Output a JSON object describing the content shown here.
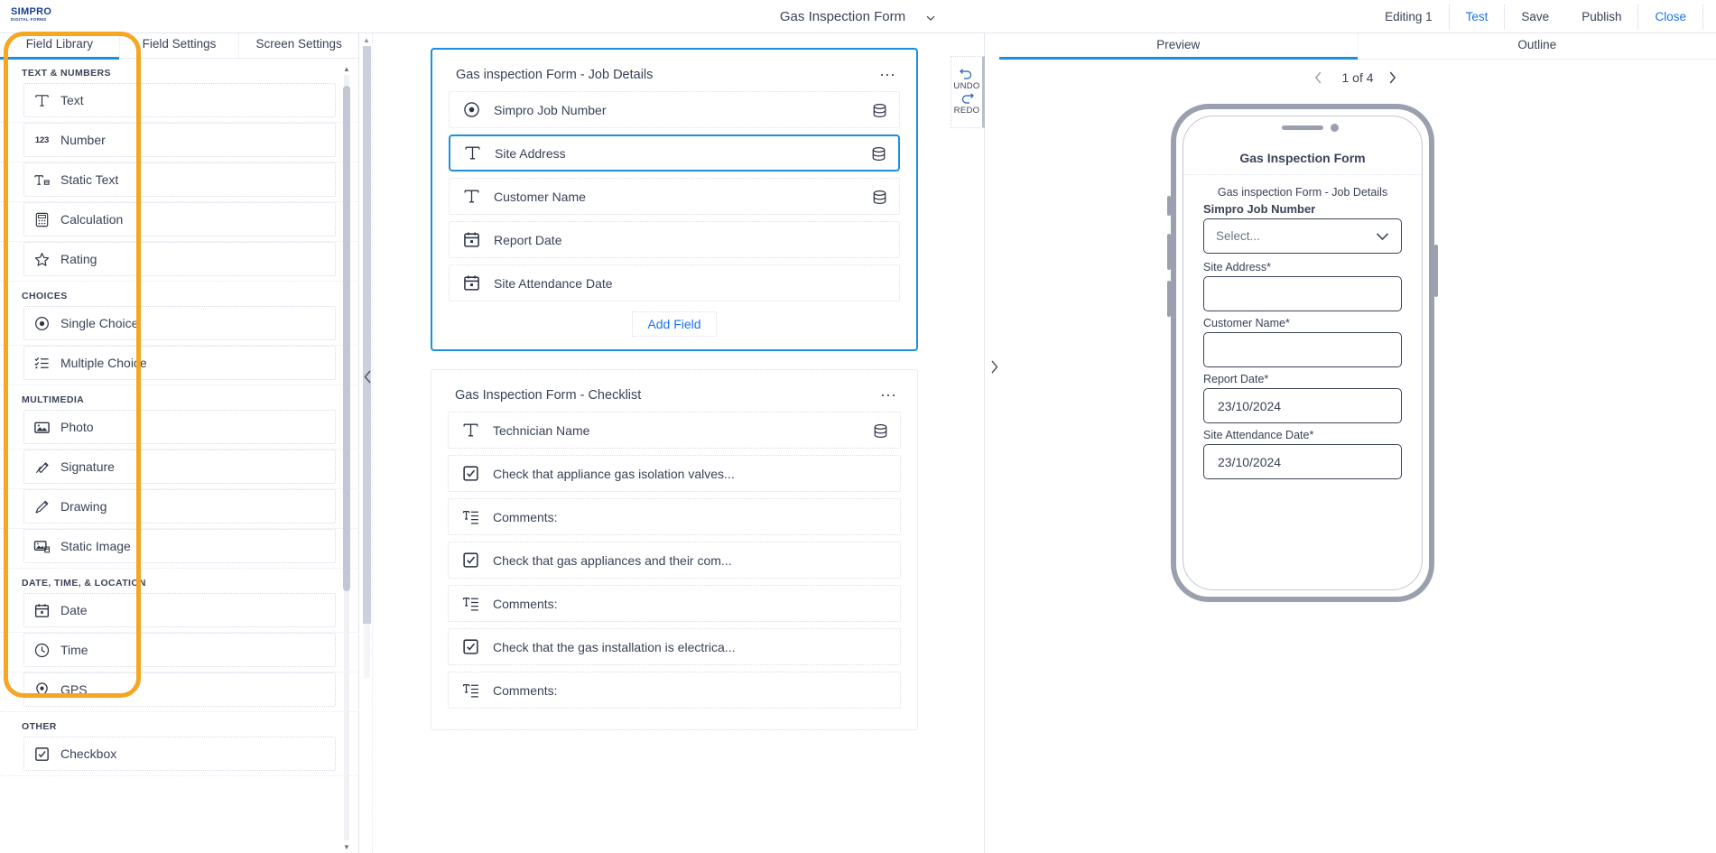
{
  "topbar": {
    "logo_main": "SIMPRO",
    "logo_sub": "DIGITAL FORMS",
    "doc_title": "Gas Inspection Form",
    "chevron_icon": "chevron-down-icon",
    "editing": "Editing 1",
    "test": "Test",
    "save": "Save",
    "publish": "Publish",
    "close": "Close"
  },
  "left_panel": {
    "tabs": [
      {
        "label": "Field Library",
        "active": true
      },
      {
        "label": "Field Settings",
        "active": false
      },
      {
        "label": "Screen Settings",
        "active": false
      }
    ],
    "groups": [
      {
        "label": "TEXT & NUMBERS",
        "items": [
          {
            "label": "Text",
            "icon": "text-icon"
          },
          {
            "label": "Number",
            "icon": "number-icon"
          },
          {
            "label": "Static Text",
            "icon": "static-text-icon"
          },
          {
            "label": "Calculation",
            "icon": "calculator-icon"
          },
          {
            "label": "Rating",
            "icon": "star-icon"
          }
        ]
      },
      {
        "label": "CHOICES",
        "items": [
          {
            "label": "Single Choice",
            "icon": "radio-button-icon"
          },
          {
            "label": "Multiple Choice",
            "icon": "checklist-icon"
          }
        ]
      },
      {
        "label": "MULTIMEDIA",
        "items": [
          {
            "label": "Photo",
            "icon": "photo-icon"
          },
          {
            "label": "Signature",
            "icon": "signature-pen-icon"
          },
          {
            "label": "Drawing",
            "icon": "pencil-icon"
          },
          {
            "label": "Static Image",
            "icon": "static-image-icon"
          }
        ]
      },
      {
        "label": "DATE, TIME, & LOCATION",
        "items": [
          {
            "label": "Date",
            "icon": "calendar-icon"
          },
          {
            "label": "Time",
            "icon": "clock-icon"
          },
          {
            "label": "GPS",
            "icon": "map-pin-icon"
          }
        ]
      },
      {
        "label": "OTHER",
        "items": [
          {
            "label": "Checkbox",
            "icon": "checkbox-icon"
          }
        ]
      }
    ]
  },
  "annotation": {
    "color": "#f5a623",
    "shape": "rounded-rectangle-highlight"
  },
  "canvas": {
    "collapse_left_icon": "chevron-left-icon",
    "collapse_right_icon": "chevron-right-icon",
    "cards": [
      {
        "title": "Gas inspection Form - Job Details",
        "selected": true,
        "menu_icon": "ellipsis-icon",
        "add_field_label": "Add Field",
        "rows": [
          {
            "label": "Simpro Job  Number",
            "icon": "radio-button-icon",
            "db": true,
            "active": false
          },
          {
            "label": "Site Address",
            "icon": "text-icon",
            "db": true,
            "active": true
          },
          {
            "label": "Customer Name",
            "icon": "text-icon",
            "db": true,
            "active": false
          },
          {
            "label": "Report Date",
            "icon": "calendar-icon",
            "db": false,
            "active": false
          },
          {
            "label": "Site Attendance Date",
            "icon": "calendar-icon",
            "db": false,
            "active": false
          }
        ]
      },
      {
        "title": "Gas Inspection Form - Checklist",
        "selected": false,
        "menu_icon": "ellipsis-icon",
        "add_field_label": "",
        "rows": [
          {
            "label": "Technician Name",
            "icon": "text-icon",
            "db": true,
            "active": false
          },
          {
            "label": "Check that appliance gas isolation valves...",
            "icon": "checkbox-icon",
            "db": false,
            "active": false
          },
          {
            "label": "Comments:",
            "icon": "multiline-text-icon",
            "db": false,
            "active": false
          },
          {
            "label": "Check that gas appliances and their com...",
            "icon": "checkbox-icon",
            "db": false,
            "active": false
          },
          {
            "label": "Comments:",
            "icon": "multiline-text-icon",
            "db": false,
            "active": false
          },
          {
            "label": "Check that the gas installation is electrica...",
            "icon": "checkbox-icon",
            "db": false,
            "active": false
          },
          {
            "label": "Comments:",
            "icon": "multiline-text-icon",
            "db": false,
            "active": false
          }
        ]
      }
    ]
  },
  "history": {
    "undo_label": "UNDO",
    "redo_label": "REDO",
    "undo_icon": "undo-arrow-icon",
    "redo_icon": "redo-arrow-icon"
  },
  "right_panel": {
    "tabs": [
      {
        "label": "Preview",
        "active": true
      },
      {
        "label": "Outline",
        "active": false
      }
    ],
    "pager": {
      "prev_icon": "chevron-left-icon",
      "next_icon": "chevron-right-icon",
      "text": "1 of 4"
    },
    "phone": {
      "form_title": "Gas Inspection Form",
      "section_title": "Gas inspection Form - Job Details",
      "fields": [
        {
          "label": "Simpro Job Number",
          "type": "select",
          "value": "Select...",
          "bold": true
        },
        {
          "label": "Site Address*",
          "type": "textarea",
          "value": ""
        },
        {
          "label": "Customer Name*",
          "type": "textarea",
          "value": ""
        },
        {
          "label": "Report Date*",
          "type": "text",
          "value": "23/10/2024"
        },
        {
          "label": "Site Attendance Date*",
          "type": "text",
          "value": "23/10/2024"
        }
      ]
    }
  },
  "colors": {
    "accent_blue": "#1a8fe3",
    "link_blue": "#1a73e8",
    "annotation_orange": "#f5a623",
    "text": "#3a4256"
  }
}
